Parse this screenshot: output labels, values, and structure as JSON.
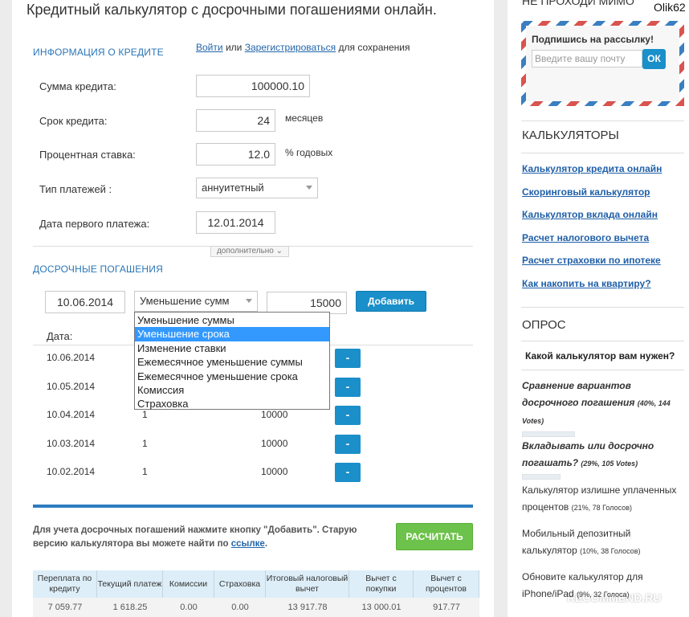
{
  "page": {
    "title": "Кредитный калькулятор с досрочными погашениями онлайн."
  },
  "auth": {
    "login": "Войти",
    "or": "или",
    "register": "Зарегистрироваться",
    "suffix": "для сохранения"
  },
  "loan": {
    "section_title": "ИНФОРМАЦИЯ О КРЕДИТЕ",
    "amount_label": "Сумма кредита:",
    "amount_value": "100000.10",
    "term_label": "Срок кредита:",
    "term_value": "24",
    "term_unit": "месяцев",
    "rate_label": "Процентная ставка:",
    "rate_value": "12.0",
    "rate_unit": "% годовых",
    "payment_type_label": "Тип платежей :",
    "payment_type_value": "аннуитетный",
    "first_date_label": "Дата первого платежа:",
    "first_date_value": "12.01.2014",
    "more_label": "дополнительно"
  },
  "early": {
    "section_title": "ДОСРОЧНЫЕ ПОГАШЕНИЯ",
    "date_value": "10.06.2014",
    "type_value": "Уменьшение сумм",
    "amount_value": "15000",
    "add_label": "Добавить",
    "options": [
      "Уменьшение суммы",
      "Уменьшение срока",
      "Изменение ставки",
      "Ежемесячное уменьшение суммы",
      "Ежемесячное уменьшение срока",
      "Комиссия",
      "Страховка"
    ],
    "selected_option": "Уменьшение срока",
    "date_header": "Дата:",
    "remove_label": "-",
    "rows": [
      {
        "date": "10.06.2014",
        "type": "",
        "amount": ""
      },
      {
        "date": "10.05.2014",
        "type": "",
        "amount": ""
      },
      {
        "date": "10.04.2014",
        "type": "1",
        "amount": "10000"
      },
      {
        "date": "10.03.2014",
        "type": "1",
        "amount": "10000"
      },
      {
        "date": "10.02.2014",
        "type": "1",
        "amount": "10000"
      }
    ]
  },
  "calc": {
    "note_text": "Для учета досрочных погашений нажмите кнопку \"Добавить\". Старую версию калькулятора вы можете найти по",
    "note_link": "ссылке",
    "note_end": ".",
    "calc_label": "РАСЧИТАТЬ"
  },
  "results": {
    "headers": [
      "Переплата по кредиту",
      "Текущий платеж",
      "Комиссии",
      "Страховка",
      "Итоговый налоговый вычет",
      "Вычет с покупки",
      "Вычет с процентов"
    ],
    "values": [
      "7 059.77",
      "1 618.25",
      "0.00",
      "0.00",
      "13 917.78",
      "13 000.01",
      "917.77"
    ]
  },
  "sidebar": {
    "top_text": "НЕ ПРОХОДИ МИМО",
    "username": "Olik62",
    "subscribe_title": "Подпишись на рассылку!",
    "email_placeholder": "Введите вашу почту",
    "ok_label": "ОК",
    "calcs_title": "КАЛЬКУЛЯТОРЫ",
    "links": [
      "Калькулятор кредита онлайн",
      "Скоринговый калькулятор",
      "Калькулятор вклада онлайн",
      "Расчет налогового вычета",
      "Расчет страховки по ипотеке",
      "Как накопить на квартиру?"
    ],
    "poll_title": "ОПРОС",
    "poll_question": "Какой калькулятор вам нужен?",
    "poll_options": [
      {
        "text": "Сравнение вариантов досрочного погашения",
        "stat": "(40%, 144 Votes)",
        "share": 0.4
      },
      {
        "text": "Вкладывать или досрочно погашать?",
        "stat": "(29%, 105 Votes)",
        "share": 0.29
      },
      {
        "text": "Калькулятор излишне уплаченных процентов",
        "stat": "(21%, 78 Голосов)",
        "share": 0.21
      },
      {
        "text": "Мобильный депозитный калькулятор",
        "stat": "(10%, 38 Голосов)",
        "share": 0.1
      },
      {
        "text": "Обновите калькулятор для iPhone/iPad",
        "stat": "(9%, 32 Голоса)",
        "share": 0.09
      }
    ],
    "watermark": "RECOMMEND.RU"
  },
  "colors": {
    "accent": "#1a8fc9",
    "link": "#1f5fa8",
    "section": "#2a76b8",
    "green": "#6cc24a"
  }
}
